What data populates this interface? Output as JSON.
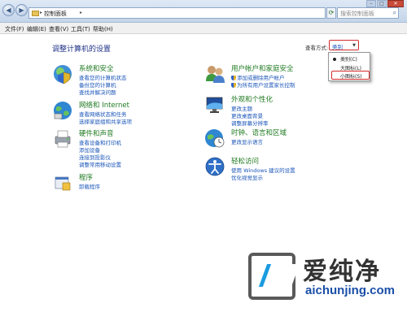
{
  "window": {
    "breadcrumb": "控制面板",
    "search_placeholder": "搜索控制面板"
  },
  "menubar": [
    "文件(F)",
    "编辑(E)",
    "查看(V)",
    "工具(T)",
    "帮助(H)"
  ],
  "main": {
    "heading": "调整计算机的设置",
    "view_by_label": "查看方式:",
    "view_by_value": "类别",
    "view_options": [
      "类别(C)",
      "大图标(L)",
      "小图标(S)"
    ],
    "view_selected": "类别(C)",
    "highlighted_option": "小图标(S)"
  },
  "categories": [
    {
      "title": "系统和安全",
      "icon": "shield-globe-icon",
      "links": [
        "查看您的计算机状态",
        "备份您的计算机",
        "查找并解决问题"
      ]
    },
    {
      "title": "网络和 Internet",
      "icon": "network-globe-icon",
      "links": [
        "查看网络状态和任务",
        "选择家庭组和共享选项"
      ]
    },
    {
      "title": "硬件和声音",
      "icon": "printer-icon",
      "links": [
        "查看设备和打印机",
        "添加设备",
        "连接到投影仪",
        "调整常用移动设置"
      ]
    },
    {
      "title": "程序",
      "icon": "programs-icon",
      "links": [
        "卸载程序"
      ]
    },
    {
      "title": "用户帐户和家庭安全",
      "icon": "users-icon",
      "links": [
        "添加或删除用户帐户",
        "为所有用户设置家长控制"
      ]
    },
    {
      "title": "外观和个性化",
      "icon": "monitor-icon",
      "links": [
        "更改主题",
        "更改桌面背景",
        "调整屏幕分辨率"
      ]
    },
    {
      "title": "时钟、语言和区域",
      "icon": "clock-globe-icon",
      "links": [
        "更改显示语言"
      ]
    },
    {
      "title": "轻松访问",
      "icon": "ease-of-access-icon",
      "links": [
        "使用 Windows 建议的设置",
        "优化视觉显示"
      ]
    }
  ],
  "watermark": {
    "brand": "爱纯净",
    "url": "aichunjing.com"
  }
}
